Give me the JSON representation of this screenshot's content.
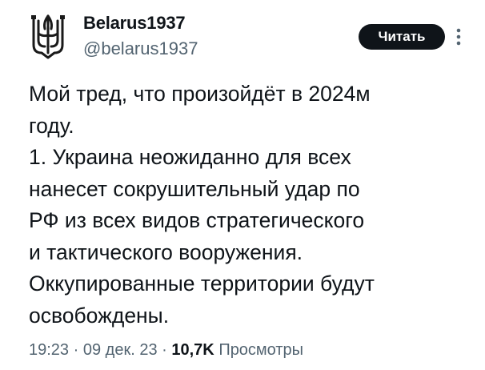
{
  "user": {
    "name": "Belarus1937",
    "handle": "@belarus1937"
  },
  "actions": {
    "follow_label": "Читать",
    "more_icon": "more-vertical-icon"
  },
  "tweet": {
    "text": "Мой тред, что произойдёт в 2024м\nгоду.\n1. Украина неожиданно для всех\nнанесет сокрушительный удар по\nРФ из всех видов стратегического\nи тактического вооружения.\nОккупированные территории будут\nосвобождены."
  },
  "meta": {
    "time": "19:23",
    "date": "09 дек. 23",
    "separator": "·",
    "views_count": "10,7K",
    "views_label": "Просмотры"
  },
  "colors": {
    "text_primary": "#0f1419",
    "text_secondary": "#536471",
    "button_bg": "#0f1419"
  }
}
